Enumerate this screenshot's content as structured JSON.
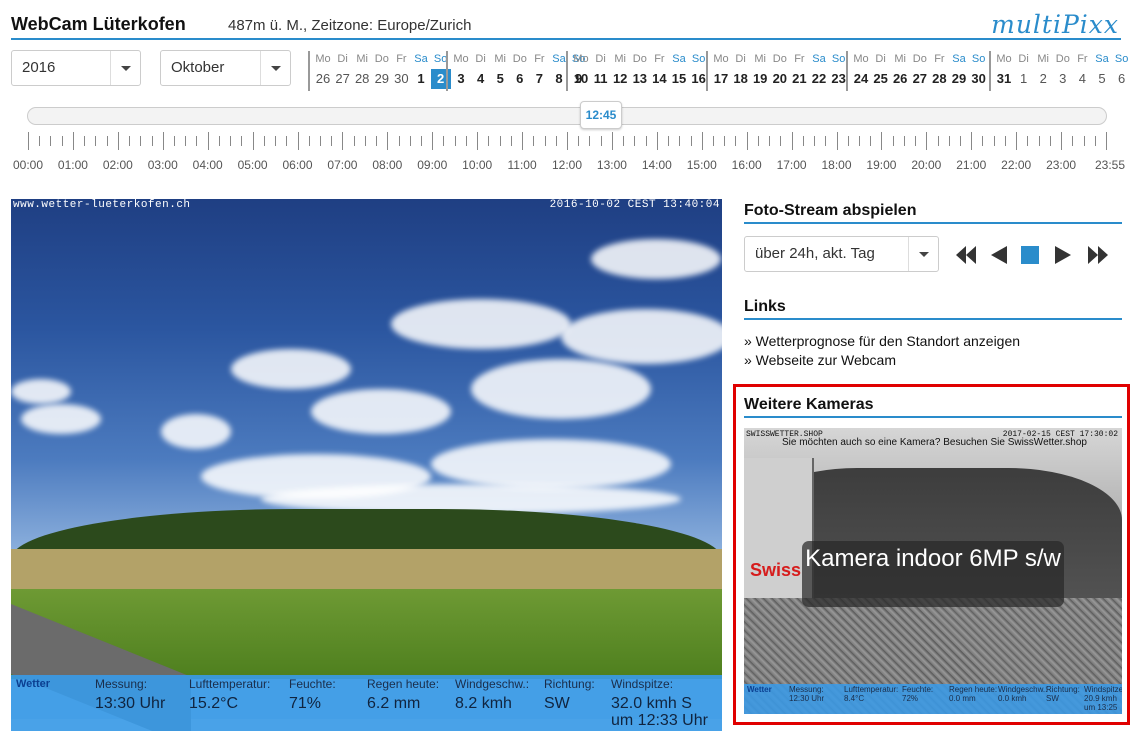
{
  "header": {
    "title": "WebCam Lüterkofen",
    "info": "487m ü. M., Zeitzone: Europe/Zurich",
    "logo": "multiPixx"
  },
  "selects": {
    "year": "2016",
    "month": "Oktober"
  },
  "calendar": {
    "selected": "2",
    "weeks": [
      [
        [
          "Mo",
          "26",
          0,
          1
        ],
        [
          "Di",
          "27",
          0,
          1
        ],
        [
          "Mi",
          "28",
          0,
          1
        ],
        [
          "Do",
          "29",
          0,
          1
        ],
        [
          "Fr",
          "30",
          0,
          1
        ],
        [
          "Sa",
          "1",
          1,
          0
        ],
        [
          "So",
          "2",
          1,
          0
        ]
      ],
      [
        [
          "Mo",
          "3",
          0,
          0
        ],
        [
          "Di",
          "4",
          0,
          0
        ],
        [
          "Mi",
          "5",
          0,
          0
        ],
        [
          "Do",
          "6",
          0,
          0
        ],
        [
          "Fr",
          "7",
          0,
          0
        ],
        [
          "Sa",
          "8",
          1,
          0
        ],
        [
          "So",
          "9",
          1,
          0
        ]
      ],
      [
        [
          "Mo",
          "10",
          0,
          0
        ],
        [
          "Di",
          "11",
          0,
          0
        ],
        [
          "Mi",
          "12",
          0,
          0
        ],
        [
          "Do",
          "13",
          0,
          0
        ],
        [
          "Fr",
          "14",
          0,
          0
        ],
        [
          "Sa",
          "15",
          1,
          0
        ],
        [
          "So",
          "16",
          1,
          0
        ]
      ],
      [
        [
          "Mo",
          "17",
          0,
          0
        ],
        [
          "Di",
          "18",
          0,
          0
        ],
        [
          "Mi",
          "19",
          0,
          0
        ],
        [
          "Do",
          "20",
          0,
          0
        ],
        [
          "Fr",
          "21",
          0,
          0
        ],
        [
          "Sa",
          "22",
          1,
          0
        ],
        [
          "So",
          "23",
          1,
          0
        ]
      ],
      [
        [
          "Mo",
          "24",
          0,
          0
        ],
        [
          "Di",
          "25",
          0,
          0
        ],
        [
          "Mi",
          "26",
          0,
          0
        ],
        [
          "Do",
          "27",
          0,
          0
        ],
        [
          "Fr",
          "28",
          0,
          0
        ],
        [
          "Sa",
          "29",
          1,
          0
        ],
        [
          "So",
          "30",
          1,
          0
        ]
      ],
      [
        [
          "Mo",
          "31",
          0,
          0
        ],
        [
          "Di",
          "1",
          0,
          1
        ],
        [
          "Mi",
          "2",
          0,
          1
        ],
        [
          "Do",
          "3",
          0,
          1
        ],
        [
          "Fr",
          "4",
          0,
          1
        ],
        [
          "Sa",
          "5",
          1,
          1
        ],
        [
          "So",
          "6",
          1,
          1
        ]
      ]
    ]
  },
  "slider": {
    "current": "12:45",
    "hours": [
      "00:00",
      "01:00",
      "02:00",
      "03:00",
      "04:00",
      "05:00",
      "06:00",
      "07:00",
      "08:00",
      "09:00",
      "10:00",
      "11:00",
      "12:00",
      "13:00",
      "14:00",
      "15:00",
      "16:00",
      "17:00",
      "18:00",
      "19:00",
      "20:00",
      "21:00",
      "22:00",
      "23:00",
      "23:55"
    ]
  },
  "webcam": {
    "stamp_left": "www.wetter-lueterkofen.ch",
    "stamp_right": "2016-10-02 CEST 13:40:04",
    "brand": "Wetter",
    "weather": [
      {
        "label": "Messung:",
        "value": "13:30 Uhr"
      },
      {
        "label": "Lufttemperatur:",
        "value": "15.2°C"
      },
      {
        "label": "Feuchte:",
        "value": "71%"
      },
      {
        "label": "Regen heute:",
        "value": "6.2 mm"
      },
      {
        "label": "Windgeschw.:",
        "value": "8.2 kmh"
      },
      {
        "label": "Richtung:",
        "value": "SW"
      },
      {
        "label": "Windspitze:",
        "value": "32.0 kmh S\num 12:33 Uhr"
      }
    ]
  },
  "stream": {
    "title": "Foto-Stream abspielen",
    "select": "über 24h, akt. Tag"
  },
  "links": {
    "title": "Links",
    "items": [
      "» Wetterprognose für den Standort anzeigen",
      "» Webseite zur Webcam"
    ]
  },
  "cameras": {
    "title": "Weitere Kameras",
    "overlay": "Kamera indoor 6MP s/w",
    "ad": "Sie möchten auch so eine Kamera? Besuchen Sie SwissWetter.shop",
    "stamp_left": "SWISSWETTER.SHOP",
    "stamp_right": "2017-02-15 CEST 17:30:02",
    "brand": "Swiss",
    "bar_brand": "Wetter",
    "bar": [
      {
        "label": "Messung:",
        "value": "12:30 Uhr"
      },
      {
        "label": "Lufttemperatur:",
        "value": "8.4°C"
      },
      {
        "label": "Feuchte:",
        "value": "72%"
      },
      {
        "label": "Regen heute:",
        "value": "0.0 mm"
      },
      {
        "label": "Windgeschw.:",
        "value": "0.0 kmh"
      },
      {
        "label": "Richtung:",
        "value": "SW"
      },
      {
        "label": "Windspitze:",
        "value": "20.9 kmh\num 13:25"
      }
    ]
  },
  "colors": {
    "accent": "#2a8ccb",
    "highlight": "#e00000"
  }
}
